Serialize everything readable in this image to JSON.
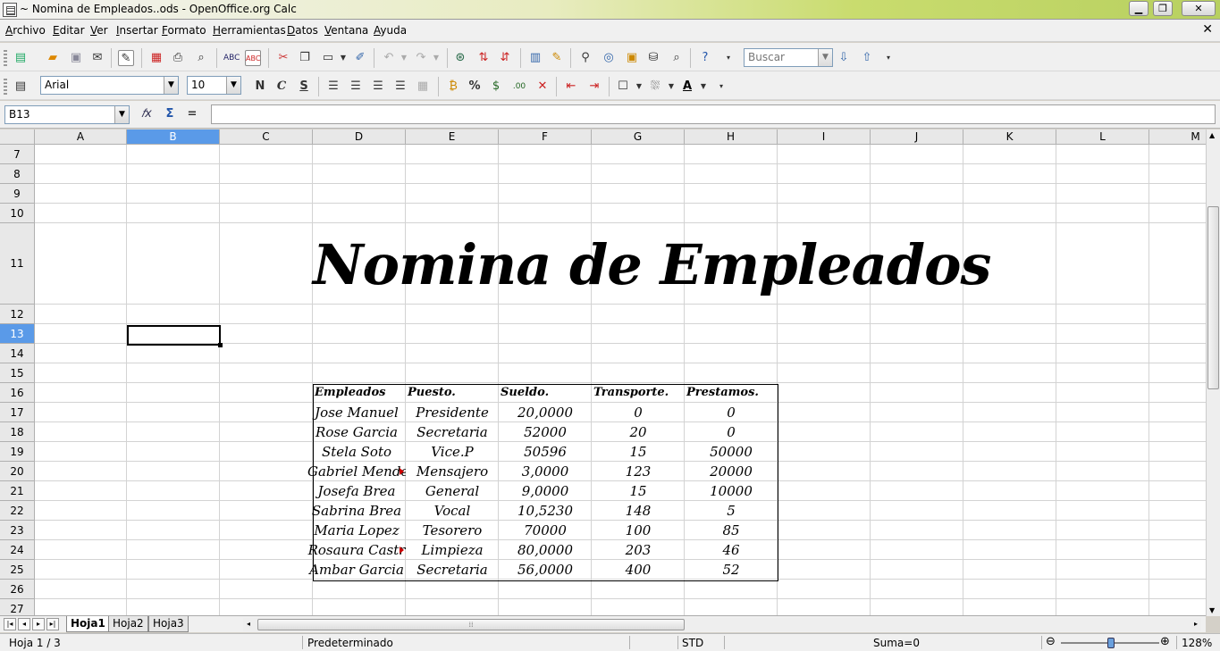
{
  "window": {
    "title": "~ Nomina de Empleados..ods - OpenOffice.org Calc",
    "min": "▁",
    "max": "❐",
    "close": "✕"
  },
  "menubar": {
    "items": [
      "Archivo",
      "Editar",
      "Ver",
      "Insertar",
      "Formato",
      "Herramientas",
      "Datos",
      "Ventana",
      "Ayuda"
    ],
    "close_doc": "✕"
  },
  "toolbar": {
    "find_placeholder": "Buscar",
    "font_name": "Arial",
    "font_size": "10",
    "bold_label": "N",
    "italic_label": "C",
    "underline_label": "S",
    "percent_label": "%"
  },
  "formula": {
    "cell_ref": "B13",
    "fx": "𝑓x",
    "sum": "Σ",
    "equals": "=",
    "content": ""
  },
  "columns": [
    "A",
    "B",
    "C",
    "D",
    "E",
    "F",
    "G",
    "H",
    "I",
    "J",
    "K",
    "L",
    "M"
  ],
  "rows": [
    "7",
    "8",
    "9",
    "10",
    "11",
    "12",
    "13",
    "14",
    "15",
    "16",
    "17",
    "18",
    "19",
    "20",
    "21",
    "22",
    "23",
    "24",
    "25",
    "26",
    "27"
  ],
  "selected": {
    "column": "B",
    "row": "13"
  },
  "sheet": {
    "title": "Nomina de Empleados",
    "headers": [
      "Empleados",
      "Puesto.",
      "Sueldo.",
      "Transporte.",
      "Prestamos."
    ],
    "records": [
      [
        "Jose Manuel",
        "Presidente",
        "20,0000",
        "0",
        "0"
      ],
      [
        "Rose Garcia",
        "Secretaria",
        "52000",
        "20",
        "0"
      ],
      [
        "Stela Soto",
        "Vice.P",
        "50596",
        "15",
        "50000"
      ],
      [
        "Gabriel Mende",
        "Mensajero",
        "3,0000",
        "123",
        "20000"
      ],
      [
        "Josefa Brea",
        "General",
        "9,0000",
        "15",
        "10000"
      ],
      [
        "Sabrina Brea",
        "Vocal",
        "10,5230",
        "148",
        "5"
      ],
      [
        "Maria Lopez",
        "Tesorero",
        "70000",
        "100",
        "85"
      ],
      [
        "Rosaura Castr",
        "Limpieza",
        "80,0000",
        "203",
        "46"
      ],
      [
        "Ambar Garcia",
        "Secretaria",
        "56,0000",
        "400",
        "52"
      ]
    ]
  },
  "tabs": [
    "Hoja1",
    "Hoja2",
    "Hoja3"
  ],
  "active_tab": "Hoja1",
  "status": {
    "sheet": "Hoja 1 / 3",
    "style": "Predeterminado",
    "mode": "STD",
    "sum": "Suma=0",
    "zoom": "128%",
    "zoom_out": "⊖",
    "zoom_in": "⊕"
  }
}
